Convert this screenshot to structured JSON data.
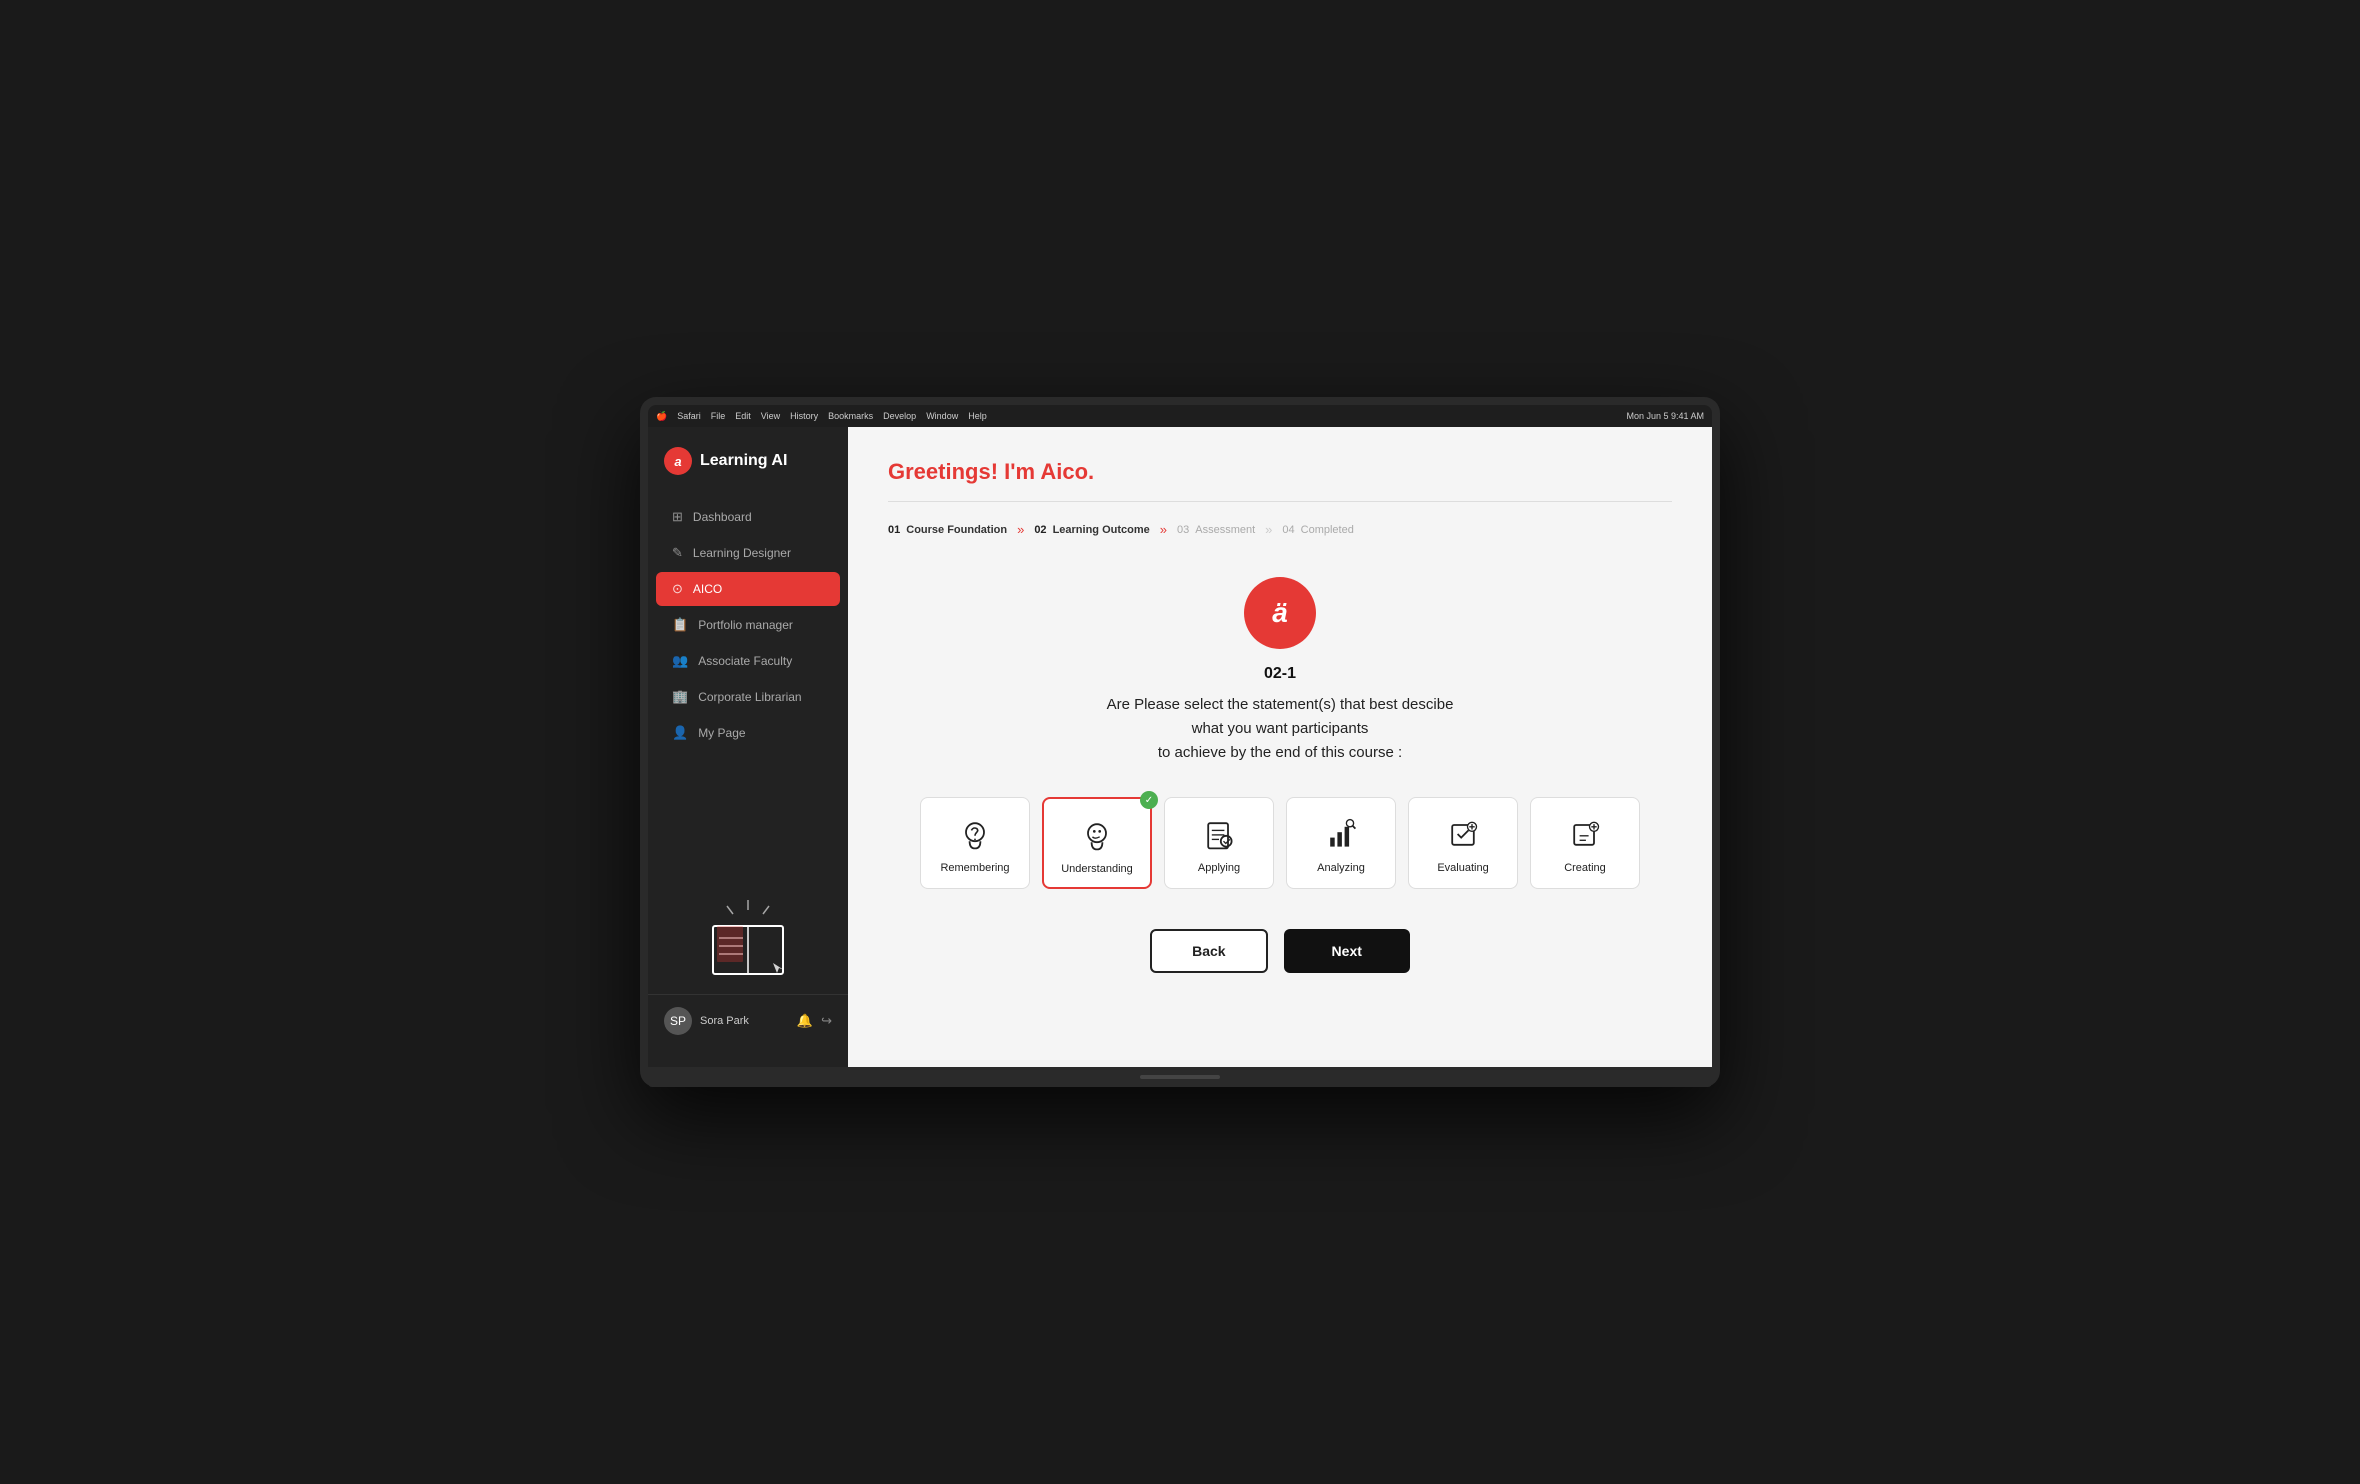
{
  "app": {
    "title": "Learning AI",
    "logo_letter": "a"
  },
  "menu_bar": {
    "apple": "🍎",
    "items": [
      "Safari",
      "File",
      "Edit",
      "View",
      "History",
      "Bookmarks",
      "Develop",
      "Window",
      "Help"
    ],
    "right": "Mon Jun 5  9:41 AM"
  },
  "sidebar": {
    "nav_items": [
      {
        "id": "dashboard",
        "label": "Dashboard",
        "icon": "⊞",
        "active": false
      },
      {
        "id": "learning-designer",
        "label": "Learning Designer",
        "icon": "✏",
        "active": false
      },
      {
        "id": "aico",
        "label": "AICO",
        "icon": "⊙",
        "active": true
      },
      {
        "id": "portfolio-manager",
        "label": "Portfolio manager",
        "icon": "📋",
        "active": false
      },
      {
        "id": "associate-faculty",
        "label": "Associate Faculty",
        "icon": "👥",
        "active": false
      },
      {
        "id": "corporate-librarian",
        "label": "Corporate Librarian",
        "icon": "🏢",
        "active": false
      },
      {
        "id": "my-page",
        "label": "My Page",
        "icon": "👤",
        "active": false
      }
    ],
    "user": {
      "name": "Sora Park",
      "avatar_initials": "SP"
    }
  },
  "main": {
    "greeting_text": "Greetings! ",
    "greeting_highlight": "I'm Aico.",
    "steps": [
      {
        "num": "01",
        "label": "Course Foundation",
        "active": true
      },
      {
        "num": "02",
        "label": "Learning Outcome",
        "active": true
      },
      {
        "num": "03",
        "label": "Assessment",
        "active": false
      },
      {
        "num": "04",
        "label": "Completed",
        "active": false
      }
    ],
    "step_indicator": "02-1",
    "question": "Are Please select the statement(s) that best descibe\nwhat you want participants\nto achieve by the end of this course :",
    "bloom_cards": [
      {
        "id": "remembering",
        "label": "Remembering",
        "selected": false
      },
      {
        "id": "understanding",
        "label": "Understanding",
        "selected": true
      },
      {
        "id": "applying",
        "label": "Applying",
        "selected": false
      },
      {
        "id": "analyzing",
        "label": "Analyzing",
        "selected": false
      },
      {
        "id": "evaluating",
        "label": "Evaluating",
        "selected": false
      },
      {
        "id": "creating",
        "label": "Creating",
        "selected": false
      }
    ],
    "buttons": {
      "back": "Back",
      "next": "Next"
    }
  }
}
